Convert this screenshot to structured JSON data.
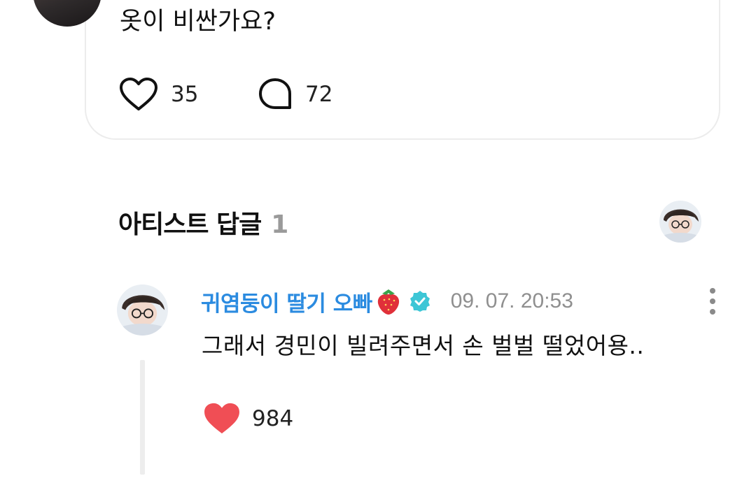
{
  "post": {
    "text": "옷이 비싼가요?",
    "like_count": "35",
    "comment_count": "72"
  },
  "artist_replies": {
    "title": "아티스트 답글",
    "count": "1"
  },
  "reply": {
    "author": "귀염둥이 딸기 오빠",
    "author_emoji": "strawberry-icon",
    "timestamp": "09. 07. 20:53",
    "text": "그래서 경민이 빌려주면서 손 벌벌 떨었어용..",
    "like_count": "984"
  },
  "colors": {
    "author_name": "#2b8be0",
    "verified_badge": "#3dc6d6",
    "heart_filled": "#f04e55",
    "muted_text": "#8f8f8f"
  }
}
